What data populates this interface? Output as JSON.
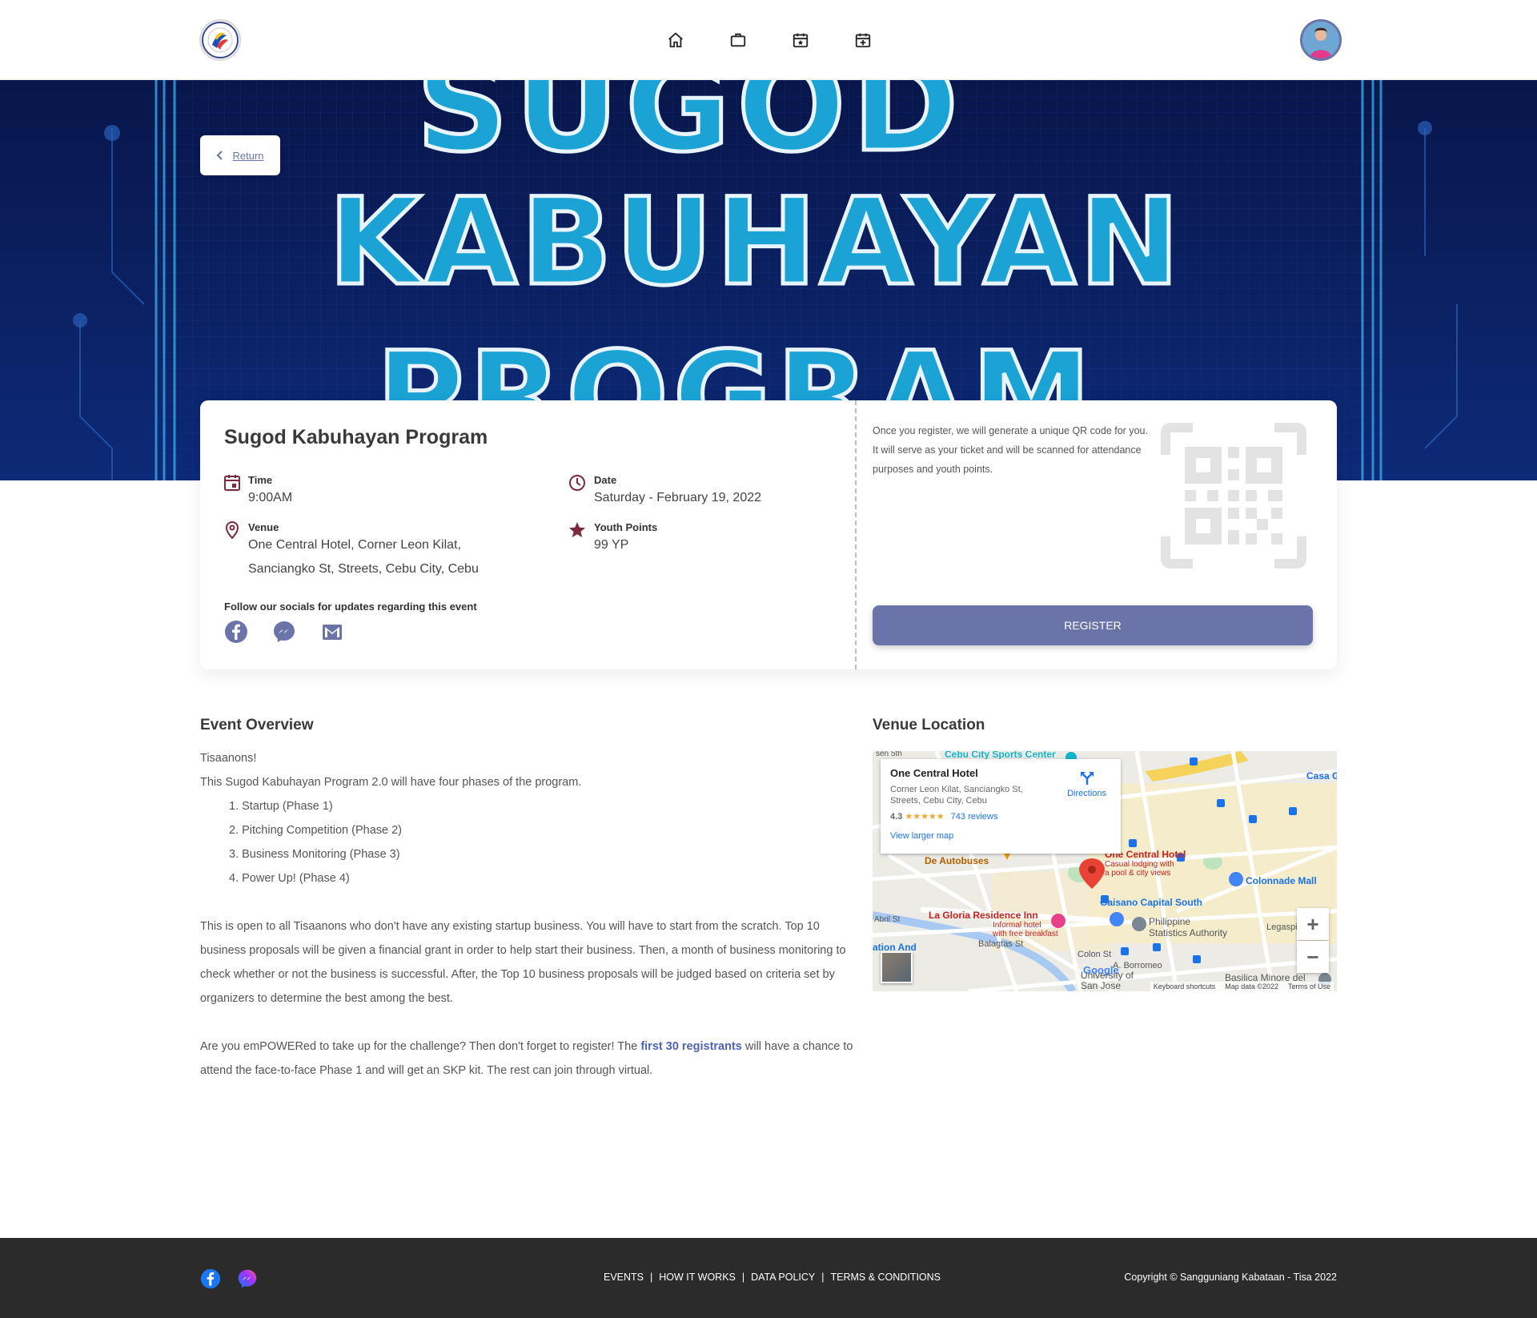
{
  "nav": {
    "icons": [
      "home-icon",
      "briefcase-icon",
      "calendar-star-icon",
      "calendar-plus-icon"
    ]
  },
  "banner": {
    "line1": "SUGOD",
    "line2": "KABUHAYAN",
    "line3": "PROGRAM"
  },
  "return_label": "Return",
  "event": {
    "title": "Sugod Kabuhayan Program",
    "time_label": "Time",
    "time_value": "9:00AM",
    "date_label": "Date",
    "date_value": "Saturday - February 19, 2022",
    "venue_label": "Venue",
    "venue_line1": "One Central Hotel, Corner Leon Kilat,",
    "venue_line2": "Sanciangko St, Streets, Cebu City, Cebu",
    "points_label": "Youth Points",
    "points_value": "99 YP",
    "social_label": "Follow our socials for updates regarding this event",
    "register_text": "Once you register, we will generate a unique QR code for you. It will serve as your ticket and will be scanned for attendance purposes and youth points.",
    "register_button": "REGISTER"
  },
  "overview": {
    "title": "Event Overview",
    "greeting": "Tisaanons!",
    "intro": "This Sugod Kabuhayan Program 2.0 will have four phases of the program.",
    "phases": [
      "1. Startup (Phase 1)",
      "2. Pitching Competition (Phase 2)",
      "3. Business Monitoring (Phase 3)",
      "4. Power Up! (Phase 4)"
    ],
    "para1": "This is open to all Tisaanons who don't have any existing startup business. You will have to start from the scratch. Top 10 business proposals will be given a financial grant in order to help start their business. Then, a month of business monitoring to check whether or not the business is successful. After, the Top 10 business proposals will be judged based on criteria set by organizers to determine the best among the best.",
    "para2_before": "Are you emPOWERed to take up for the challenge? Then don't forget to register! The ",
    "para2_highlight": "first 30 registrants",
    "para2_after": " will have a chance to attend the face-to-face Phase 1 and will get an SKP kit. The rest can join through virtual."
  },
  "venue": {
    "title": "Venue Location",
    "map_card_title": "One Central Hotel",
    "map_card_address": "Corner Leon Kilat, Sanciangko St, Streets, Cebu City, Cebu",
    "rating": "4.3",
    "stars": "★★★★★",
    "reviews": "743 reviews",
    "directions": "Directions",
    "larger_map": "View larger map",
    "zoom_in": "+",
    "zoom_out": "−",
    "labels": {
      "sports_center": "Cebu City Sports Center",
      "casa": "Casa G",
      "one_central": "One Central Hotel",
      "one_central_sub1": "Casual lodging with",
      "one_central_sub2": "a pool & city views",
      "de_autobuses": "De Autobuses",
      "colonnade": "Colonnade Mall",
      "gaisano": "Gaisano Capital South",
      "la_gloria": "La Gloria Residence Inn",
      "la_gloria_sub1": "Informal hotel",
      "la_gloria_sub2": "with free breakfast",
      "psa1": "Philippine",
      "psa2": "Statistics Authority",
      "balagtas": "Balagtas St",
      "colon": "Colon St",
      "borromeo": "A. Borromeo",
      "legaspi": "Legaspi",
      "university": "University of",
      "san_jose": "San Jose",
      "basilica": "Basilica Minore del",
      "abril": "Abril St",
      "osmena": "sen 5th",
      "ation": "ation And",
      "google": "Google"
    },
    "footer_shortcuts": "Keyboard shortcuts",
    "footer_mapdata": "Map data ©2022",
    "footer_terms": "Terms of Use"
  },
  "footer": {
    "links": [
      "EVENTS",
      "HOW IT WORKS",
      "DATA POLICY",
      "TERMS & CONDITIONS"
    ],
    "separator": "|",
    "copyright": "Copyright © Sangguniang Kabataan - Tisa 2022"
  },
  "colors": {
    "accent": "#6b74a8",
    "icon_maroon": "#7a2a3d",
    "banner_bg": "#0b1c55",
    "banner_text": "#1ba3d6",
    "footer_bg": "#2b2b2b"
  }
}
